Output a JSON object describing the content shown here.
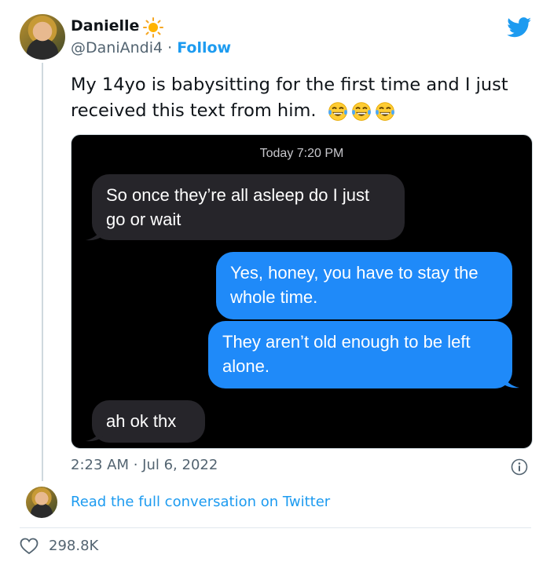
{
  "tweet": {
    "display_name": "Danielle",
    "handle": "@DaniAndi4",
    "separator": " · ",
    "follow_label": "Follow",
    "text": "My 14yo is babysitting for the first time and I just received this text from him.",
    "timestamp": "2:23 AM · Jul 6, 2022",
    "read_link": "Read the full conversation on Twitter",
    "likes": "298.8K",
    "emojis": [
      "tears-of-joy",
      "tears-of-joy",
      "tears-of-joy"
    ]
  },
  "screenshot": {
    "time_header": "Today 7:20 PM",
    "messages": [
      {
        "direction": "received",
        "text": "So once they’re all asleep do I just go or wait"
      },
      {
        "direction": "sent",
        "text": "Yes, honey, you have to stay the whole time."
      },
      {
        "direction": "sent",
        "text": "They aren’t old enough to be left alone."
      },
      {
        "direction": "received",
        "text": "ah ok thx"
      }
    ]
  },
  "colors": {
    "twitter_blue": "#1d9bf0",
    "imessage_blue": "#1f8af9",
    "received_bubble": "#26252a",
    "muted_text": "#536471"
  },
  "icons": [
    "sun-icon",
    "twitter-bird-icon",
    "info-icon",
    "heart-icon"
  ]
}
